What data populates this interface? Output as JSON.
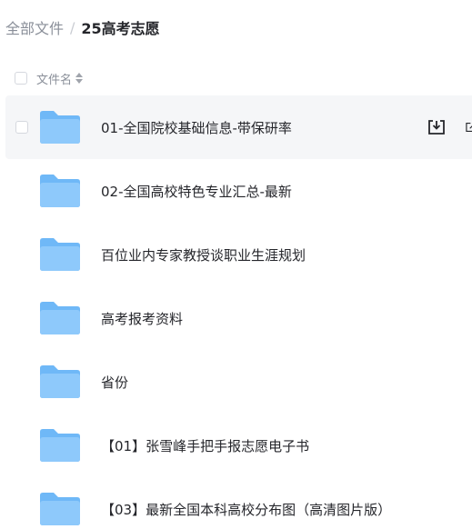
{
  "breadcrumb": {
    "root": "全部文件",
    "separator": "/",
    "current": "25高考志愿"
  },
  "list_header": {
    "name_label": "文件名"
  },
  "files": [
    {
      "name": "01-全国院校基础信息-带保研率",
      "icon": "folder-icon"
    },
    {
      "name": "02-全国高校特色专业汇总-最新",
      "icon": "folder-icon"
    },
    {
      "name": "百位业内专家教授谈职业生涯规划",
      "icon": "folder-icon"
    },
    {
      "name": "高考报考资料",
      "icon": "folder-icon"
    },
    {
      "name": "省份",
      "icon": "folder-icon"
    },
    {
      "name": "【01】张雪峰手把手报志愿电子书",
      "icon": "folder-icon"
    },
    {
      "name": "【03】最新全国本科高校分布图（高清图片版）",
      "icon": "folder-icon"
    }
  ],
  "row_actions": {
    "download_icon": "download-icon",
    "share_icon": "share-icon"
  },
  "colors": {
    "folder_body": "#8ec9fb",
    "folder_tab": "#6fb8f7",
    "hover_row": "#f5f6f8",
    "text_primary": "#25262b",
    "text_secondary": "#8a8f99"
  }
}
